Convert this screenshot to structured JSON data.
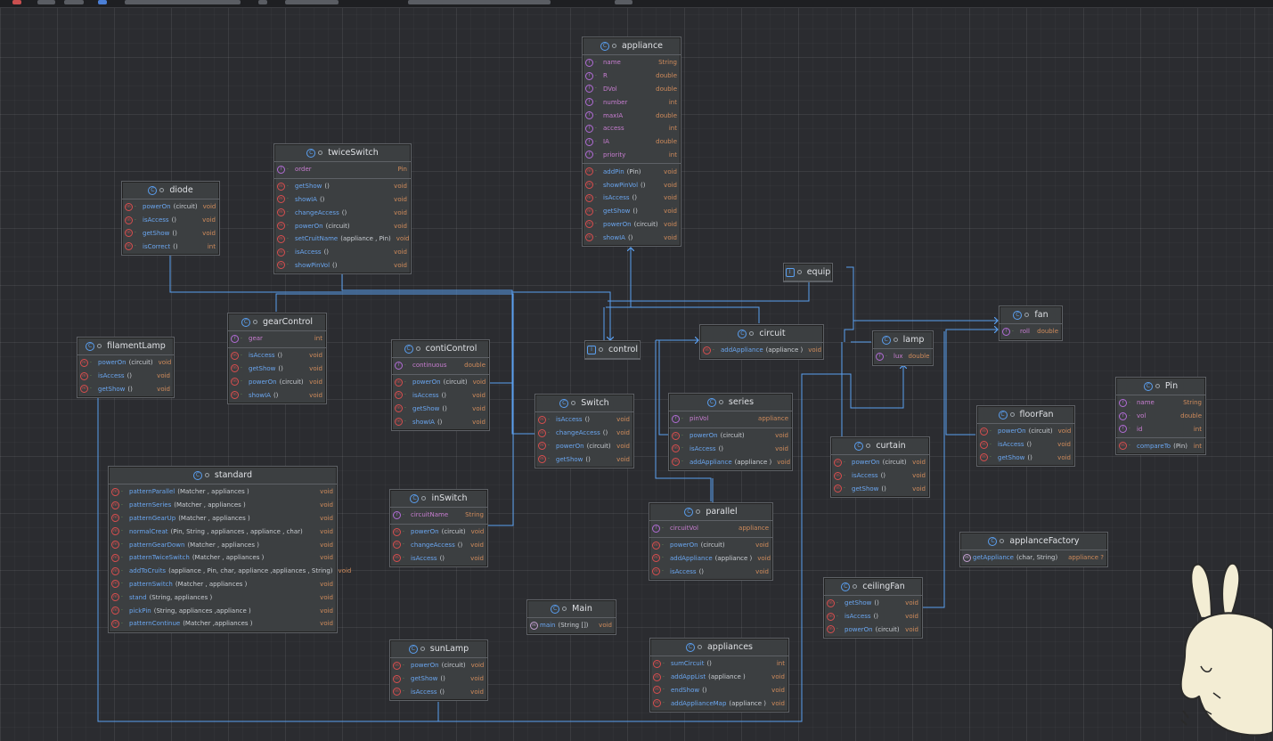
{
  "diagram": {
    "appliance": {
      "title": "appliance",
      "fields": [
        {
          "name": "name",
          "type": "String"
        },
        {
          "name": "R",
          "type": "double"
        },
        {
          "name": "DVol",
          "type": "double"
        },
        {
          "name": "number",
          "type": "int"
        },
        {
          "name": "maxIA",
          "type": "double"
        },
        {
          "name": "access",
          "type": "int"
        },
        {
          "name": "IA",
          "type": "double"
        },
        {
          "name": "priority",
          "type": "int"
        }
      ],
      "methods": [
        {
          "name": "addPin",
          "params": "(Pin)",
          "type": "void"
        },
        {
          "name": "showPinVol",
          "params": "()",
          "type": "void"
        },
        {
          "name": "isAccess",
          "params": "()",
          "type": "void"
        },
        {
          "name": "getShow",
          "params": "()",
          "type": "void"
        },
        {
          "name": "powerOn",
          "params": "(circuit)",
          "type": "void"
        },
        {
          "name": "showIA",
          "params": "()",
          "type": "void"
        }
      ]
    },
    "twiceSwitch": {
      "title": "twiceSwitch",
      "fields": [
        {
          "name": "order",
          "type": "Pin"
        }
      ],
      "methods": [
        {
          "name": "getShow",
          "params": "()",
          "type": "void"
        },
        {
          "name": "showIA",
          "params": "()",
          "type": "void"
        },
        {
          "name": "changeAccess",
          "params": "()",
          "type": "void"
        },
        {
          "name": "powerOn",
          "params": "(circuit)",
          "type": "void"
        },
        {
          "name": "setCruitName",
          "params": "(appliance , Pin)",
          "type": "void"
        },
        {
          "name": "isAccess",
          "params": "()",
          "type": "void"
        },
        {
          "name": "showPinVol",
          "params": "()",
          "type": "void"
        }
      ]
    },
    "diode": {
      "title": "diode",
      "methods": [
        {
          "name": "powerOn",
          "params": "(circuit)",
          "type": "void"
        },
        {
          "name": "isAccess",
          "params": "()",
          "type": "void"
        },
        {
          "name": "getShow",
          "params": "()",
          "type": "void"
        },
        {
          "name": "isCorrect",
          "params": "()",
          "type": "int"
        }
      ]
    },
    "gearControl": {
      "title": "gearControl",
      "fields": [
        {
          "name": "gear",
          "type": "int"
        }
      ],
      "methods": [
        {
          "name": "isAccess",
          "params": "()",
          "type": "void"
        },
        {
          "name": "getShow",
          "params": "()",
          "type": "void"
        },
        {
          "name": "powerOn",
          "params": "(circuit)",
          "type": "void"
        },
        {
          "name": "showIA",
          "params": "()",
          "type": "void"
        }
      ]
    },
    "filamentLamp": {
      "title": "filamentLamp",
      "methods": [
        {
          "name": "powerOn",
          "params": "(circuit)",
          "type": "void"
        },
        {
          "name": "isAccess",
          "params": "()",
          "type": "void"
        },
        {
          "name": "getShow",
          "params": "()",
          "type": "void"
        }
      ]
    },
    "contiControl": {
      "title": "contiControl",
      "fields": [
        {
          "name": "continuous",
          "type": "double"
        }
      ],
      "methods": [
        {
          "name": "powerOn",
          "params": "(circuit)",
          "type": "void"
        },
        {
          "name": "isAccess",
          "params": "()",
          "type": "void"
        },
        {
          "name": "getShow",
          "params": "()",
          "type": "void"
        },
        {
          "name": "showIA",
          "params": "()",
          "type": "void"
        }
      ]
    },
    "control": {
      "title": "control"
    },
    "circuit": {
      "title": "circuit",
      "methods": [
        {
          "name": "addAppliance",
          "params": "(appliance )",
          "type": "void"
        }
      ]
    },
    "equip": {
      "title": "equip"
    },
    "lamp": {
      "title": "lamp",
      "fields": [
        {
          "name": "lux",
          "type": "double"
        }
      ]
    },
    "fan": {
      "title": "fan",
      "fields": [
        {
          "name": "roll",
          "type": "double"
        }
      ]
    },
    "Switch": {
      "title": "Switch",
      "methods": [
        {
          "name": "isAccess",
          "params": "()",
          "type": "void"
        },
        {
          "name": "changeAccess",
          "params": "()",
          "type": "void"
        },
        {
          "name": "powerOn",
          "params": "(circuit)",
          "type": "void"
        },
        {
          "name": "getShow",
          "params": "()",
          "type": "void"
        }
      ]
    },
    "series": {
      "title": "series",
      "fields": [
        {
          "name": "pinVol",
          "type": "appliance"
        }
      ],
      "methods": [
        {
          "name": "powerOn",
          "params": "(circuit)",
          "type": "void"
        },
        {
          "name": "isAccess",
          "params": "()",
          "type": "void"
        },
        {
          "name": "addAppliance",
          "params": "(appliance )",
          "type": "void"
        }
      ]
    },
    "Pin": {
      "title": "Pin",
      "fields": [
        {
          "name": "name",
          "type": "String"
        },
        {
          "name": "vol",
          "type": "double"
        },
        {
          "name": "id",
          "type": "int"
        }
      ],
      "methods": [
        {
          "name": "compareTo",
          "params": "(Pin)",
          "type": "int"
        }
      ]
    },
    "floorFan": {
      "title": "floorFan",
      "methods": [
        {
          "name": "powerOn",
          "params": "(circuit)",
          "type": "void"
        },
        {
          "name": "isAccess",
          "params": "()",
          "type": "void"
        },
        {
          "name": "getShow",
          "params": "()",
          "type": "void"
        }
      ]
    },
    "curtain": {
      "title": "curtain",
      "methods": [
        {
          "name": "powerOn",
          "params": "(circuit)",
          "type": "void"
        },
        {
          "name": "isAccess",
          "params": "()",
          "type": "void"
        },
        {
          "name": "getShow",
          "params": "()",
          "type": "void"
        }
      ]
    },
    "standard": {
      "title": "standard",
      "methods": [
        {
          "name": "patternParallel",
          "params": "(Matcher , appliances )",
          "type": "void"
        },
        {
          "name": "patternSeries",
          "params": "(Matcher , appliances )",
          "type": "void"
        },
        {
          "name": "patternGearUp",
          "params": "(Matcher , appliances )",
          "type": "void"
        },
        {
          "name": "normalCreat",
          "params": "(Pin, String , appliances , appliance , char)",
          "type": "void"
        },
        {
          "name": "patternGearDown",
          "params": "(Matcher , appliances )",
          "type": "void"
        },
        {
          "name": "patternTwiceSwitch",
          "params": "(Matcher , appliances )",
          "type": "void"
        },
        {
          "name": "addToCruits",
          "params": "(appliance , Pin, char, appliance ,appliances , String)",
          "type": "void"
        },
        {
          "name": "patternSwitch",
          "params": "(Matcher , appliances )",
          "type": "void"
        },
        {
          "name": "stand",
          "params": "(String, appliances )",
          "type": "void"
        },
        {
          "name": "pickPin",
          "params": "(String, appliances ,appliance )",
          "type": "void"
        },
        {
          "name": "patternContinue",
          "params": "(Matcher ,appliances )",
          "type": "void"
        }
      ]
    },
    "inSwitch": {
      "title": "inSwitch",
      "fields": [
        {
          "name": "circuitName",
          "type": "String"
        }
      ],
      "methods": [
        {
          "name": "powerOn",
          "params": "(circuit)",
          "type": "void"
        },
        {
          "name": "changeAccess",
          "params": "()",
          "type": "void"
        },
        {
          "name": "isAccess",
          "params": "()",
          "type": "void"
        }
      ]
    },
    "parallel": {
      "title": "parallel",
      "fields": [
        {
          "name": "circuitVol",
          "type": "appliance"
        }
      ],
      "methods": [
        {
          "name": "powerOn",
          "params": "(circuit)",
          "type": "void"
        },
        {
          "name": "addAppliance",
          "params": "(appliance )",
          "type": "void"
        },
        {
          "name": "isAccess",
          "params": "()",
          "type": "void"
        }
      ]
    },
    "applanceFactory": {
      "title": "applanceFactory",
      "methods": [
        {
          "name": "getAppliance",
          "params": "(char, String)",
          "type": "appliance ?"
        }
      ]
    },
    "ceilingFan": {
      "title": "ceilingFan",
      "methods": [
        {
          "name": "getShow",
          "params": "()",
          "type": "void"
        },
        {
          "name": "isAccess",
          "params": "()",
          "type": "void"
        },
        {
          "name": "powerOn",
          "params": "(circuit)",
          "type": "void"
        }
      ]
    },
    "Main": {
      "title": "Main",
      "methods": [
        {
          "name": "main",
          "params": "(String [])",
          "type": "void"
        }
      ]
    },
    "sunLamp": {
      "title": "sunLamp",
      "methods": [
        {
          "name": "powerOn",
          "params": "(circuit)",
          "type": "void"
        },
        {
          "name": "getShow",
          "params": "()",
          "type": "void"
        },
        {
          "name": "isAccess",
          "params": "()",
          "type": "void"
        }
      ]
    },
    "appliances": {
      "title": "appliances",
      "methods": [
        {
          "name": "sumCircuit",
          "params": "()",
          "type": "int"
        },
        {
          "name": "addAppList",
          "params": "(appliance )",
          "type": "void"
        },
        {
          "name": "endShow",
          "params": "()",
          "type": "void"
        },
        {
          "name": "addApplianceMap",
          "params": "(appliance )",
          "type": "void"
        }
      ]
    }
  },
  "colors": {
    "background": "#2b2c30",
    "box": "#3c3f41",
    "border": "#5e6166",
    "arrow": "#5a9ff0",
    "method_name": "#6aa6f0",
    "field_name": "#c77dd0",
    "type": "#d08b5b"
  }
}
